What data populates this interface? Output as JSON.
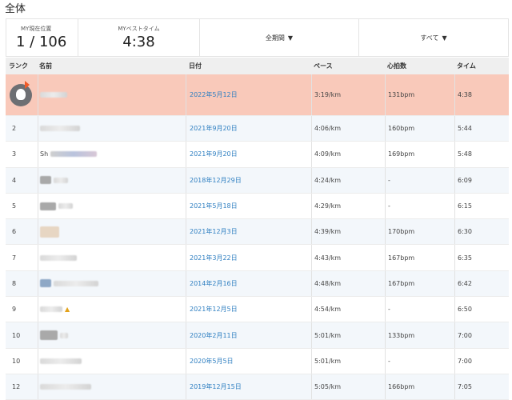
{
  "section_title": "全体",
  "summary": {
    "position_label": "MY現在位置",
    "position_value": "1 / 106",
    "best_label": "MYベストタイム",
    "best_value": "4:38",
    "period_label": "全期間",
    "filter_label": "すべて"
  },
  "columns": {
    "rank": "ランク",
    "name": "名前",
    "date": "日付",
    "pace": "ペース",
    "heart_rate": "心拍数",
    "time": "タイム"
  },
  "rows": [
    {
      "rank": "",
      "date": "2022年5月12日",
      "pace": "3:19/km",
      "hr": "131bpm",
      "time": "4:38",
      "me": true
    },
    {
      "rank": "2",
      "date": "2021年9月20日",
      "pace": "4:06/km",
      "hr": "160bpm",
      "time": "5:44"
    },
    {
      "rank": "3",
      "name_prefix": "Sh",
      "date": "2021年9月20日",
      "pace": "4:09/km",
      "hr": "169bpm",
      "time": "5:48"
    },
    {
      "rank": "4",
      "date": "2018年12月29日",
      "pace": "4:24/km",
      "hr": "-",
      "time": "6:09"
    },
    {
      "rank": "5",
      "date": "2021年5月18日",
      "pace": "4:29/km",
      "hr": "-",
      "time": "6:15"
    },
    {
      "rank": "6",
      "date": "2021年12月3日",
      "pace": "4:39/km",
      "hr": "170bpm",
      "time": "6:30"
    },
    {
      "rank": "7",
      "date": "2021年3月22日",
      "pace": "4:43/km",
      "hr": "167bpm",
      "time": "6:35"
    },
    {
      "rank": "8",
      "date": "2014年2月16日",
      "pace": "4:48/km",
      "hr": "167bpm",
      "time": "6:42"
    },
    {
      "rank": "9",
      "date": "2021年12月5日",
      "pace": "4:54/km",
      "hr": "-",
      "time": "6:50"
    },
    {
      "rank": "10",
      "date": "2020年2月11日",
      "pace": "5:01/km",
      "hr": "133bpm",
      "time": "7:00"
    },
    {
      "rank": "10",
      "date": "2020年5月5日",
      "pace": "5:01/km",
      "hr": "-",
      "time": "7:00"
    },
    {
      "rank": "12",
      "date": "2019年12月15日",
      "pace": "5:05/km",
      "hr": "166bpm",
      "time": "7:05"
    }
  ],
  "colors": {
    "highlight_row": "#f9c9ba",
    "link": "#2f7fc1",
    "header_bg": "#efefef"
  }
}
